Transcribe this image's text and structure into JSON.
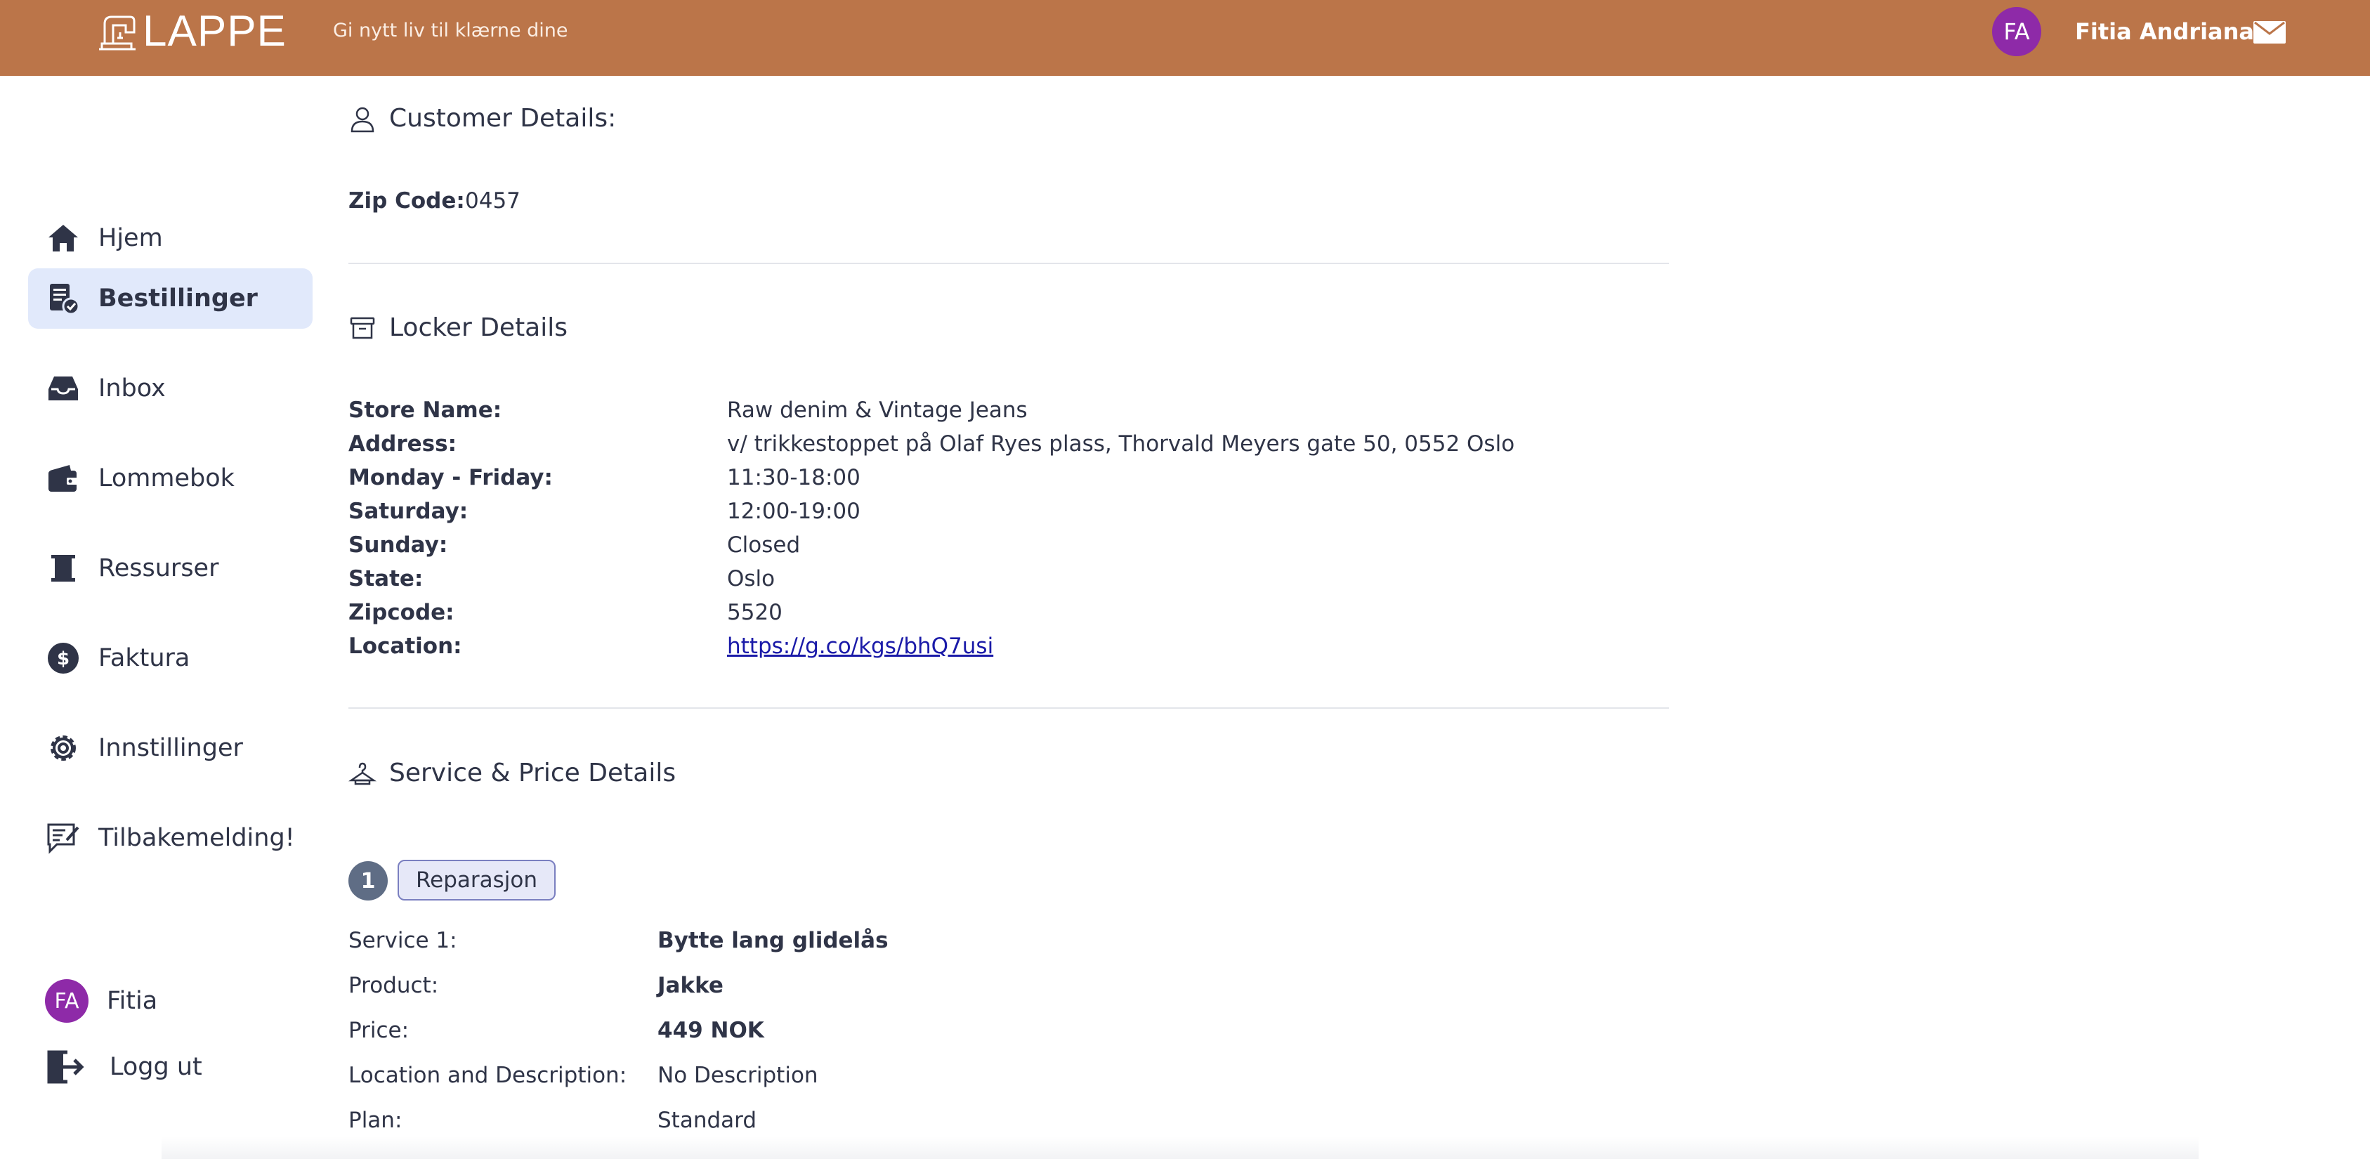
{
  "header": {
    "logo_text": "LAPPE",
    "tagline": "Gi nytt liv til klærne dine",
    "user_initials": "FA",
    "user_name": "Fitia Andriana",
    "brand_color": "#bb7549"
  },
  "sidebar": {
    "items": [
      {
        "label": "Hjem",
        "icon": "home-icon"
      },
      {
        "label": "Bestillinger",
        "icon": "orders-icon",
        "active": true
      },
      {
        "label": "Inbox",
        "icon": "inbox-icon"
      },
      {
        "label": "Lommebok",
        "icon": "wallet-icon"
      },
      {
        "label": "Ressurser",
        "icon": "resources-icon"
      },
      {
        "label": "Faktura",
        "icon": "dollar-icon"
      },
      {
        "label": "Innstillinger",
        "icon": "gear-icon"
      },
      {
        "label": "Tilbakemelding!",
        "icon": "feedback-icon"
      }
    ],
    "user_initials": "FA",
    "user_name": "Fitia",
    "logout_label": "Logg ut"
  },
  "customer": {
    "title": "Customer Details:",
    "zip_label": "Zip Code:",
    "zip_value": "0457"
  },
  "locker": {
    "title": "Locker Details",
    "rows": [
      {
        "label": "Store Name:",
        "value": "Raw denim & Vintage Jeans"
      },
      {
        "label": "Address:",
        "value": "v/ trikkestoppet på Olaf Ryes plass, Thorvald Meyers gate 50, 0552 Oslo"
      },
      {
        "label": "Monday - Friday:",
        "value": "11:30-18:00"
      },
      {
        "label": "Saturday:",
        "value": "12:00-19:00"
      },
      {
        "label": "Sunday:",
        "value": "Closed"
      },
      {
        "label": "State:",
        "value": "Oslo"
      },
      {
        "label": "Zipcode:",
        "value": "5520"
      },
      {
        "label": "Location:",
        "value": "https://g.co/kgs/bhQ7usi"
      }
    ]
  },
  "service": {
    "title": "Service & Price Details",
    "step_number": "1",
    "chip_label": "Reparasjon",
    "rows": [
      {
        "label": "Service 1:",
        "value": "Bytte lang glidelås"
      },
      {
        "label": "Product:",
        "value": "Jakke"
      },
      {
        "label": "Price:",
        "value": "449 NOK"
      },
      {
        "label": "Location and Description:",
        "value": "No Description"
      },
      {
        "label": "Plan:",
        "value": "Standard"
      }
    ]
  }
}
